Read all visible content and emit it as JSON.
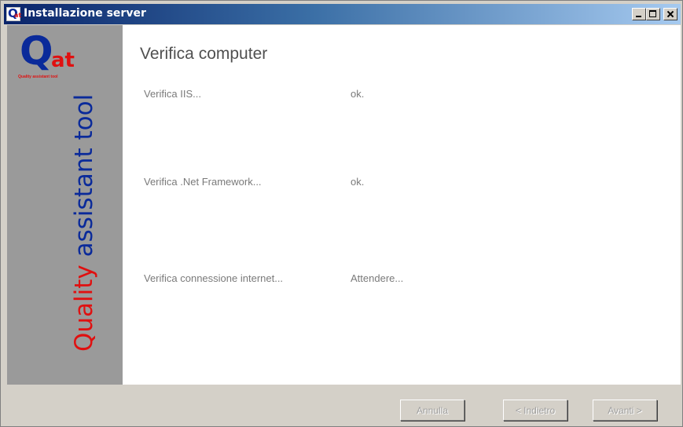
{
  "window": {
    "title": "Installazione server"
  },
  "logo": {
    "letter": "Q",
    "suffix": "at",
    "tagline": "Quality assistant tool"
  },
  "sidebar": {
    "word_red": "Quality",
    "word_blue": " assistant tool"
  },
  "page": {
    "title": "Verifica computer",
    "checks": [
      {
        "label": "Verifica IIS...",
        "status": "ok."
      },
      {
        "label": "Verifica .Net Framework...",
        "status": "ok."
      },
      {
        "label": "Verifica connessione internet...",
        "status": "Attendere..."
      }
    ]
  },
  "buttons": {
    "cancel": "Annulla",
    "back": "< Indietro",
    "next": "Avanti >"
  },
  "colors": {
    "brand_blue": "#0a2a9a",
    "brand_red": "#e01010",
    "sidebar_gray": "#9a9a9a"
  }
}
